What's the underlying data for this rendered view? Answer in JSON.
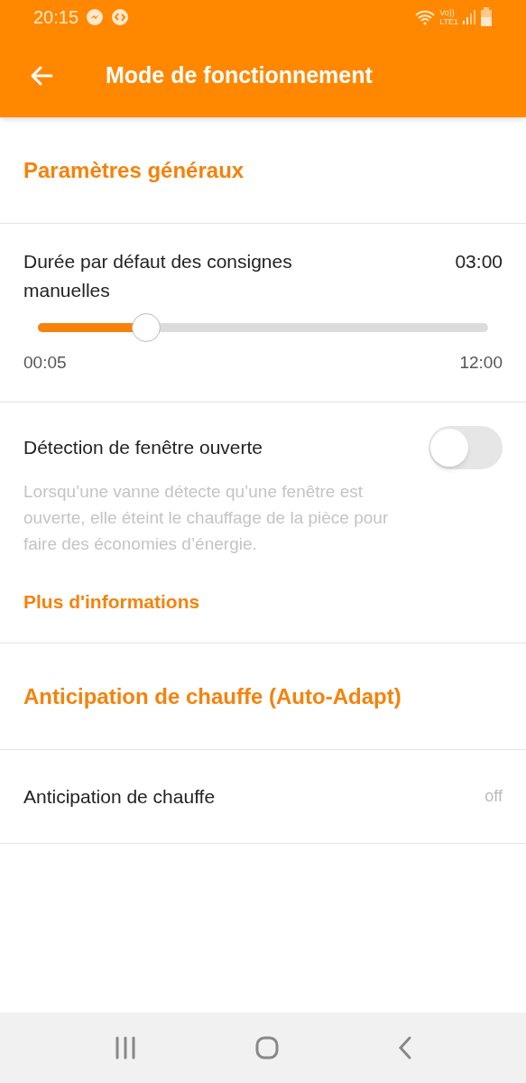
{
  "status_bar": {
    "time": "20:15",
    "network": "Vo))\nLTE1"
  },
  "app_bar": {
    "title": "Mode de fonctionnement"
  },
  "sections": [
    {
      "title": "Paramètres généraux",
      "items": [
        {
          "kind": "slider",
          "label": "Durée par défaut des consignes manuelles",
          "value": "03:00",
          "level": 0.24,
          "min_label": "00:05",
          "max_label": "12:00"
        },
        {
          "kind": "toggle",
          "label": "Détection de fenêtre ouverte",
          "on": false,
          "description": "Lorsqu’une vanne détecte qu’une fenêtre est ouverte, elle éteint le chauffage de la pièce pour faire des économies d’énergie.",
          "link": "Plus d'informations"
        }
      ]
    },
    {
      "title": "Anticipation de chauffe (Auto-Adapt)",
      "items": [
        {
          "kind": "value",
          "label": "Anticipation de chauffe",
          "value": "off"
        }
      ]
    }
  ]
}
